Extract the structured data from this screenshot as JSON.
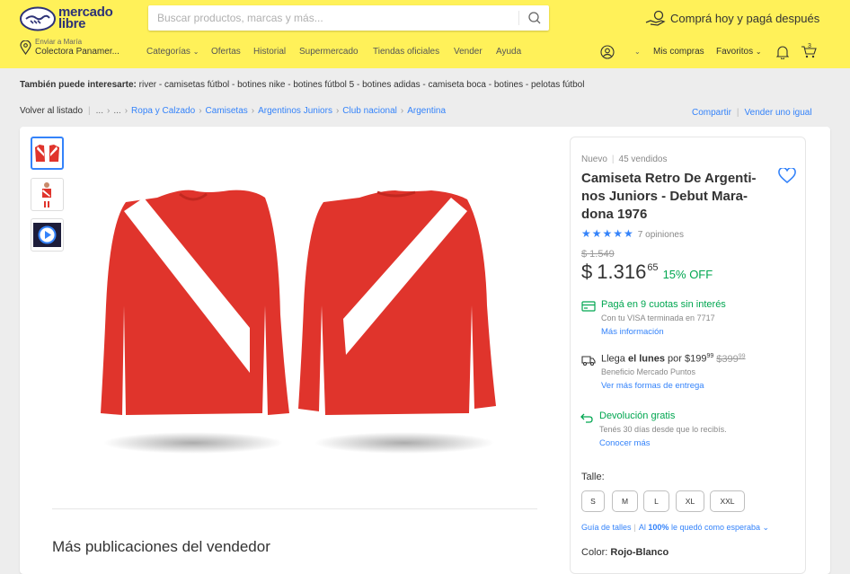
{
  "header": {
    "logo_line1": "mercado",
    "logo_line2": "libre",
    "search_placeholder": "Buscar productos, marcas y más...",
    "promo": "Comprá hoy y pagá después",
    "address_label": "Enviar a María",
    "address_value": "Colectora Panamer...",
    "nav": [
      "Categorías",
      "Ofertas",
      "Historial",
      "Supermercado",
      "Tiendas oficiales",
      "Vender",
      "Ayuda"
    ],
    "my_purchases": "Mis compras",
    "favorites": "Favoritos",
    "cart_count": "3"
  },
  "suggestions": {
    "label": "También puede interesarte:",
    "items": "river - camisetas fútbol - botines nike - botines fútbol 5 - botines adidas - camiseta boca - botines - pelotas fútbol"
  },
  "breadcrumb": {
    "back": "Volver al listado",
    "dots1": "...",
    "dots2": "...",
    "items": [
      "Ropa y Calzado",
      "Camisetas",
      "Argentinos Juniors",
      "Club nacional",
      "Argentina"
    ],
    "share": "Compartir",
    "sell_same": "Vender uno igual"
  },
  "product": {
    "condition": "Nuevo",
    "sold": "45 vendidos",
    "title": "Camiseta Retro De Argenti-nos Juniors - Debut Mara-dona 1976",
    "stars": "★★★★★",
    "rating": 5,
    "reviews": "7 opiniones",
    "old_price": "$ 1.549",
    "currency": "$",
    "price_int": "1.316",
    "price_cents": "65",
    "discount": "15% OFF",
    "installments_title": "Pagá en 9 cuotas sin interés",
    "installments_sub": "Con tu VISA terminada en 7717",
    "installments_link": "Más información",
    "shipping_title_a": "Llega ",
    "shipping_title_b": "el lunes",
    "shipping_title_c": " por $199",
    "shipping_cents": "99",
    "shipping_old": "$399",
    "shipping_old_cents": "99",
    "shipping_sub": "Beneficio Mercado Puntos",
    "shipping_link": "Ver más formas de entrega",
    "return_title": "Devolución gratis",
    "return_sub": "Tenés 30 días desde que lo recibís.",
    "return_link": "Conocer más",
    "size_label": "Talle:",
    "sizes": [
      "S",
      "M",
      "L",
      "XL",
      "XXL"
    ],
    "size_guide": "Guía de talles",
    "fit_a": "Al ",
    "fit_b": "100%",
    "fit_c": " le quedó como esperaba",
    "color_label": "Color: ",
    "color_value": "Rojo-Blanco"
  },
  "seller_section": "Más publicaciones del vendedor",
  "colors": {
    "header_yellow": "#fff159",
    "link_blue": "#3483fa",
    "green": "#00a650",
    "shirt_red": "#e0342c"
  }
}
